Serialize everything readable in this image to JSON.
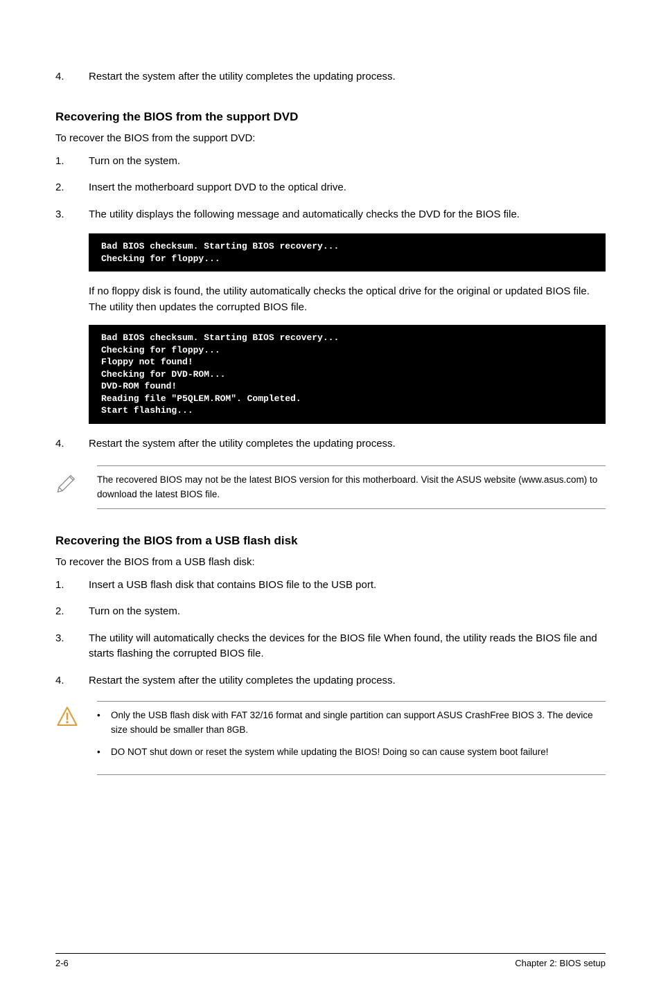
{
  "top_step": {
    "num": "4.",
    "text": "Restart the system after the utility completes the updating process."
  },
  "section1": {
    "heading": "Recovering the BIOS from the support DVD",
    "intro": "To recover the BIOS from the support DVD:",
    "steps": [
      {
        "num": "1.",
        "text": "Turn on the system."
      },
      {
        "num": "2.",
        "text": "Insert the motherboard support DVD to the optical drive."
      },
      {
        "num": "3.",
        "text": "The utility displays the following message and automatically checks the DVD for the BIOS file."
      }
    ],
    "terminal1": "Bad BIOS checksum. Starting BIOS recovery...\nChecking for floppy...",
    "indented_text": "If no floppy disk is found, the utility automatically checks the optical drive for the original or updated BIOS file. The utility then updates the corrupted BIOS file.",
    "terminal2": "Bad BIOS checksum. Starting BIOS recovery...\nChecking for floppy...\nFloppy not found!\nChecking for DVD-ROM...\nDVD-ROM found!\nReading file \"P5QLEM.ROM\". Completed.\nStart flashing...",
    "final_step": {
      "num": "4.",
      "text": "Restart the system after the utility completes the updating process."
    },
    "note": "The recovered BIOS may not be the latest BIOS version for this motherboard. Visit the ASUS website (www.asus.com) to download the latest BIOS file."
  },
  "section2": {
    "heading": "Recovering the BIOS from a USB flash disk",
    "intro": "To recover the BIOS from a USB flash disk:",
    "steps": [
      {
        "num": "1.",
        "text": "Insert a USB flash disk that contains BIOS file to the USB port."
      },
      {
        "num": "2.",
        "text": "Turn on the system."
      },
      {
        "num": "3.",
        "text": "The utility will automatically checks the devices for the BIOS file When found, the utility reads the BIOS file and starts flashing the corrupted BIOS file."
      },
      {
        "num": "4.",
        "text": "Restart the system after the utility completes the updating process."
      }
    ],
    "warnings": [
      "Only the USB flash disk with FAT 32/16 format and single partition can support ASUS CrashFree BIOS 3. The device size should be smaller than 8GB.",
      "DO NOT shut down or reset the system while updating the BIOS! Doing so can cause system boot failure!"
    ]
  },
  "footer": {
    "left": "2-6",
    "right": "Chapter 2: BIOS setup"
  }
}
